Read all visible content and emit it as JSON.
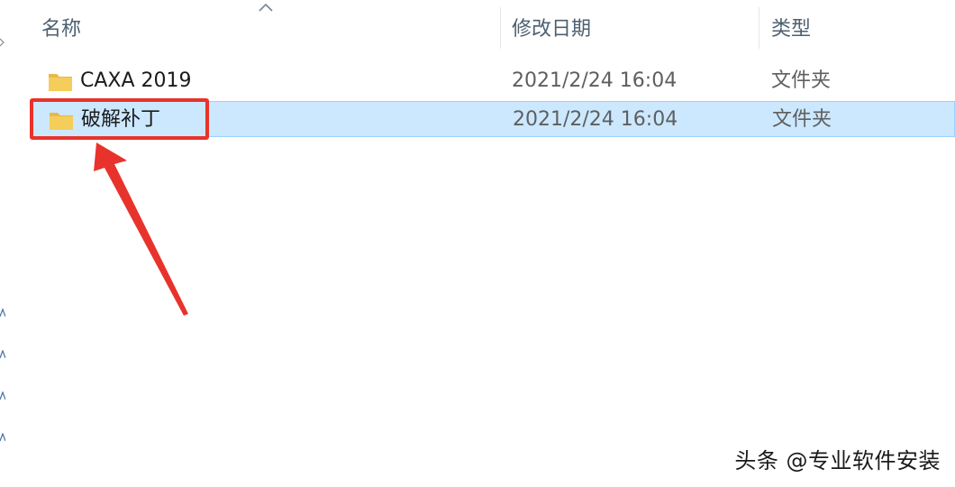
{
  "header": {
    "name_label": "名称",
    "date_label": "修改日期",
    "type_label": "类型",
    "sort_icon": "chevron-up-icon"
  },
  "rows": [
    {
      "icon": "folder-icon",
      "name": "CAXA 2019",
      "date": "2021/2/24 16:04",
      "type": "文件夹",
      "selected": false
    },
    {
      "icon": "folder-icon",
      "name": "破解补丁",
      "date": "2021/2/24 16:04",
      "type": "文件夹",
      "selected": true
    }
  ],
  "annotation": {
    "highlight_color": "#e8332c",
    "arrow_color": "#e8332c"
  },
  "watermark": "头条 @专业软件安装",
  "colors": {
    "selection_fill": "#cce8ff",
    "selection_border": "#99d1ff",
    "folder_yellow": "#f5cd5a"
  }
}
